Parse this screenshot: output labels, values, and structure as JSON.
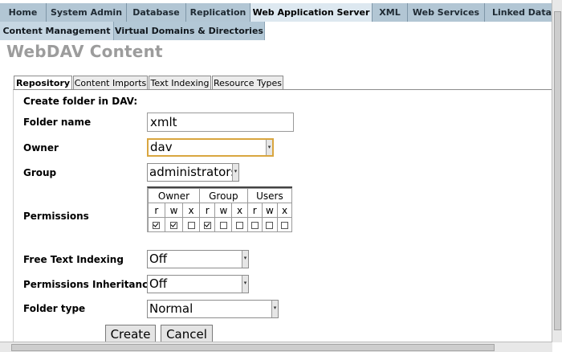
{
  "nav": {
    "top": [
      {
        "label": "Home"
      },
      {
        "label": "System Admin"
      },
      {
        "label": "Database"
      },
      {
        "label": "Replication"
      },
      {
        "label": "Web Application Server"
      },
      {
        "label": "XML"
      },
      {
        "label": "Web Services"
      },
      {
        "label": "Linked Data O"
      }
    ],
    "sub": [
      {
        "label": "Content Management"
      },
      {
        "label": "Virtual Domains & Directories"
      }
    ]
  },
  "page": {
    "title": "WebDAV Content",
    "tabs": [
      {
        "label": "Repository"
      },
      {
        "label": "Content Imports"
      },
      {
        "label": "Text Indexing"
      },
      {
        "label": "Resource Types"
      }
    ]
  },
  "form": {
    "section_title": "Create folder in DAV:",
    "folder_name": {
      "label": "Folder name",
      "value": "xmlt"
    },
    "owner": {
      "label": "Owner",
      "value": "dav"
    },
    "group": {
      "label": "Group",
      "value": "administrators"
    },
    "permissions": {
      "label": "Permissions",
      "groups": [
        "Owner",
        "Group",
        "Users"
      ],
      "bits": [
        "r",
        "w",
        "x",
        "r",
        "w",
        "x",
        "r",
        "w",
        "x"
      ],
      "checked": [
        true,
        true,
        false,
        true,
        false,
        false,
        false,
        false,
        false
      ]
    },
    "free_text_indexing": {
      "label": "Free Text Indexing",
      "value": "Off"
    },
    "permissions_inheritance": {
      "label": "Permissions Inheritance",
      "value": "Off"
    },
    "folder_type": {
      "label": "Folder type",
      "value": "Normal"
    },
    "create_label": "Create",
    "cancel_label": "Cancel"
  }
}
